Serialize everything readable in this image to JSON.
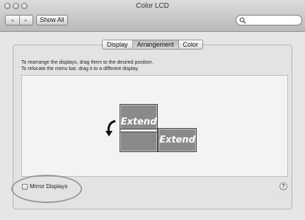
{
  "window": {
    "title": "Color LCD"
  },
  "toolbar": {
    "back_icon": "left-arrow-icon",
    "forward_icon": "right-arrow-icon",
    "back_glyph": "◂",
    "forward_glyph": "▸",
    "show_all_label": "Show All",
    "search_icon": "magnifier-icon",
    "search_value": ""
  },
  "tabs": [
    {
      "label": "Display",
      "selected": false
    },
    {
      "label": "Arrangement",
      "selected": true
    },
    {
      "label": "Color",
      "selected": false
    }
  ],
  "instructions": {
    "line1": "To rearrange the displays, drag them to the desired position.",
    "line2": "To relocate the menu bar, drag it to a different display."
  },
  "displays": {
    "main_label": "Extend",
    "secondary_label": "Extend",
    "arrow_icon": "curved-arrow-icon"
  },
  "mirror": {
    "label": "Mirror Displays",
    "checked": false
  },
  "help": {
    "glyph": "?"
  }
}
